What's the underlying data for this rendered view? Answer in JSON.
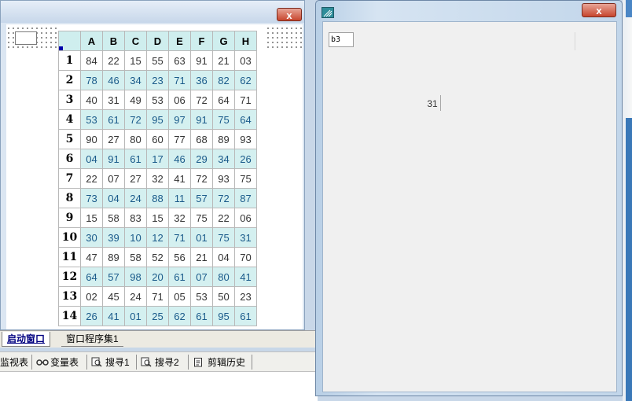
{
  "left_window": {
    "close_glyph": "x",
    "column_headers": [
      "A",
      "B",
      "C",
      "D",
      "E",
      "F",
      "G",
      "H"
    ],
    "rows": [
      {
        "num": "1",
        "cells": [
          "84",
          "22",
          "15",
          "55",
          "63",
          "91",
          "21",
          "03"
        ]
      },
      {
        "num": "2",
        "cells": [
          "78",
          "46",
          "34",
          "23",
          "71",
          "36",
          "82",
          "62"
        ]
      },
      {
        "num": "3",
        "cells": [
          "40",
          "31",
          "49",
          "53",
          "06",
          "72",
          "64",
          "71"
        ]
      },
      {
        "num": "4",
        "cells": [
          "53",
          "61",
          "72",
          "95",
          "97",
          "91",
          "75",
          "64"
        ]
      },
      {
        "num": "5",
        "cells": [
          "90",
          "27",
          "80",
          "60",
          "77",
          "68",
          "89",
          "93"
        ]
      },
      {
        "num": "6",
        "cells": [
          "04",
          "91",
          "61",
          "17",
          "46",
          "29",
          "34",
          "26"
        ]
      },
      {
        "num": "7",
        "cells": [
          "22",
          "07",
          "27",
          "32",
          "41",
          "72",
          "93",
          "75"
        ]
      },
      {
        "num": "8",
        "cells": [
          "73",
          "04",
          "24",
          "88",
          "11",
          "57",
          "72",
          "87"
        ]
      },
      {
        "num": "9",
        "cells": [
          "15",
          "58",
          "83",
          "15",
          "32",
          "75",
          "22",
          "06"
        ]
      },
      {
        "num": "10",
        "cells": [
          "30",
          "39",
          "10",
          "12",
          "71",
          "01",
          "75",
          "31"
        ]
      },
      {
        "num": "11",
        "cells": [
          "47",
          "89",
          "58",
          "52",
          "56",
          "21",
          "04",
          "70"
        ]
      },
      {
        "num": "12",
        "cells": [
          "64",
          "57",
          "98",
          "20",
          "61",
          "07",
          "80",
          "41"
        ]
      },
      {
        "num": "13",
        "cells": [
          "02",
          "45",
          "24",
          "71",
          "05",
          "53",
          "50",
          "23"
        ]
      },
      {
        "num": "14",
        "cells": [
          "26",
          "41",
          "01",
          "25",
          "62",
          "61",
          "95",
          "61"
        ]
      }
    ]
  },
  "tabs": [
    {
      "label": "启动窗口"
    },
    {
      "label": "窗口程序集1"
    }
  ],
  "toolbar": [
    {
      "label": "监视表",
      "icon": "watch-icon"
    },
    {
      "label": "变量表",
      "icon": "glasses-icon"
    },
    {
      "label": "搜寻1",
      "icon": "search-icon"
    },
    {
      "label": "搜寻2",
      "icon": "search-icon"
    },
    {
      "label": "剪辑历史",
      "icon": "clipboard-icon"
    }
  ],
  "right_window": {
    "close_glyph": "x",
    "edit_value": "b3",
    "label_value": "31"
  },
  "colors": {
    "header_bg": "#cfeeee",
    "alt_row_bg": "#d4f0f0",
    "close_button": "#c7452d"
  }
}
